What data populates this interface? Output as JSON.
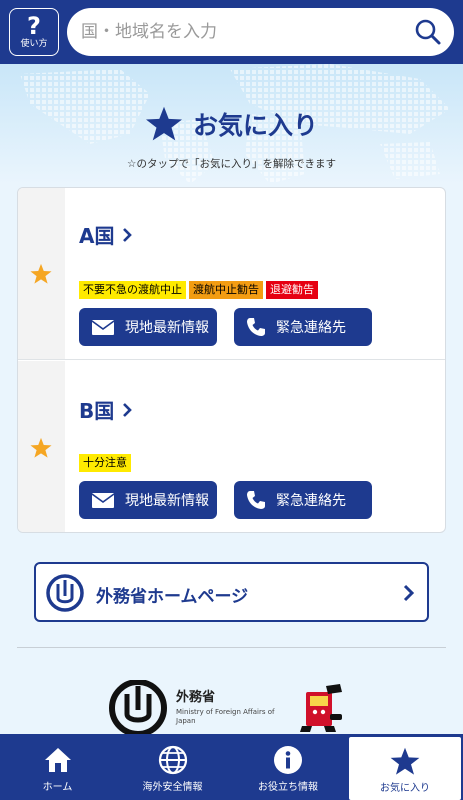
{
  "header": {
    "help_label": "使い方",
    "help_symbol": "?",
    "search_placeholder": "国・地域名を入力"
  },
  "favorites": {
    "title": "お気に入り",
    "note": "☆のタップで「お気に入り」を解除できます"
  },
  "countries": [
    {
      "name": "A国",
      "badges": [
        {
          "label": "不要不急の渡航中止",
          "color": "#ffea00"
        },
        {
          "label": "渡航中止勧告",
          "color": "#f39c12"
        },
        {
          "label": "退避勧告",
          "color": "#e60012"
        }
      ],
      "info_button": "現地最新情報",
      "contact_button": "緊急連絡先"
    },
    {
      "name": "B国",
      "badges": [
        {
          "label": "十分注意",
          "color": "#ffea00"
        }
      ],
      "info_button": "現地最新情報",
      "contact_button": "緊急連絡先"
    }
  ],
  "mofa_link": {
    "label": "外務省ホームページ"
  },
  "footer": {
    "org_name_jp": "外務省",
    "org_name_en": "Ministry of Foreign Affairs of Japan"
  },
  "tabs": [
    {
      "label": "ホーム",
      "icon": "home-icon"
    },
    {
      "label": "海外安全情報",
      "icon": "globe-icon"
    },
    {
      "label": "お役立ち情報",
      "icon": "info-icon"
    },
    {
      "label": "お気に入り",
      "icon": "star-icon",
      "active": true
    }
  ],
  "colors": {
    "brand": "#1e3a8f",
    "star": "#f5a623",
    "background": "#eaf5fd"
  }
}
